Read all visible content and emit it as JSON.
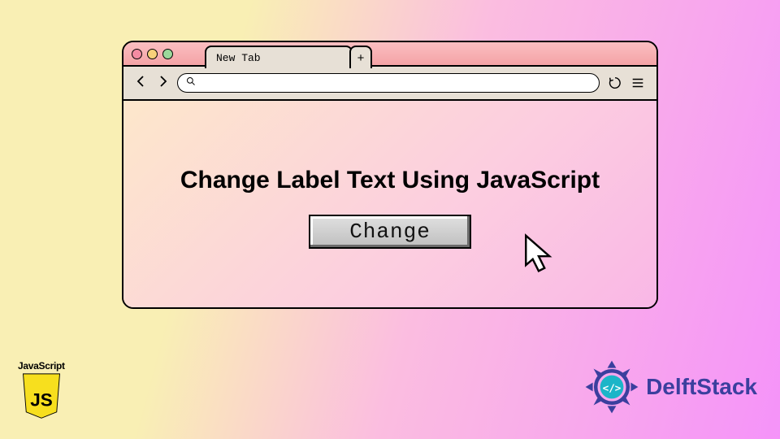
{
  "browser": {
    "tab_label": "New Tab",
    "new_tab_symbol": "+",
    "traffic_lights": [
      "#f48ba2",
      "#f7d07a",
      "#9bd89b"
    ]
  },
  "content": {
    "headline": "Change Label Text Using JavaScript",
    "button_label": "Change"
  },
  "logos": {
    "js": {
      "label": "JavaScript",
      "shield_text": "JS",
      "shield_color": "#f7df1e"
    },
    "delftstack": {
      "text": "DelftStack",
      "color": "#3b3f9e"
    }
  }
}
